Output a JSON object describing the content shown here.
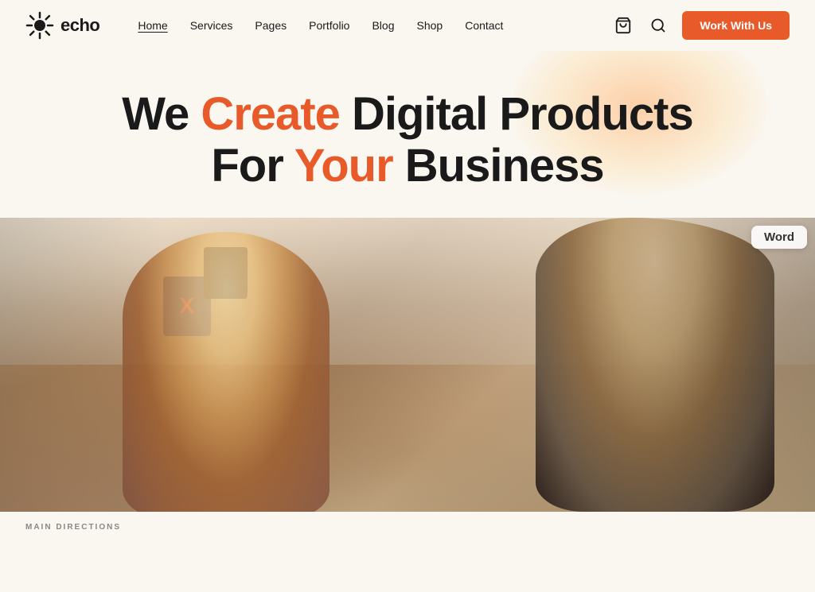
{
  "logo": {
    "text": "echo"
  },
  "nav": {
    "links": [
      {
        "label": "Home",
        "active": true
      },
      {
        "label": "Services",
        "active": false
      },
      {
        "label": "Pages",
        "active": false
      },
      {
        "label": "Portfolio",
        "active": false
      },
      {
        "label": "Blog",
        "active": false
      },
      {
        "label": "Shop",
        "active": false
      },
      {
        "label": "Contact",
        "active": false
      }
    ],
    "cta": "Work With Us"
  },
  "hero": {
    "line1_pre": "We ",
    "line1_highlight": "Create",
    "line1_post": " Digital Products",
    "line2_pre": "For ",
    "line2_highlight": "Your",
    "line2_post": " Business"
  },
  "word_badge": "Word",
  "bottom": {
    "label": "MAIN DIRECTIONS"
  }
}
